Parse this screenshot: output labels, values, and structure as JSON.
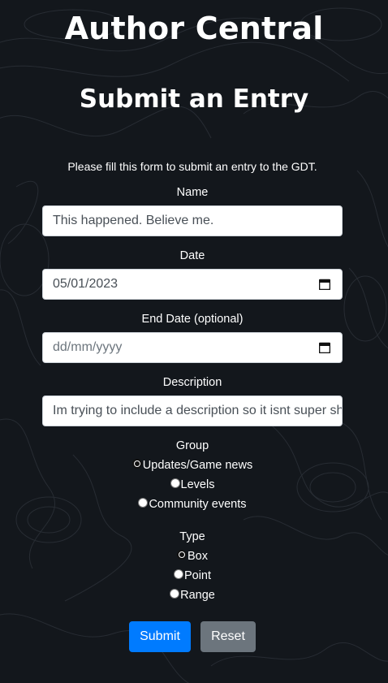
{
  "header": {
    "site_title": "Author Central",
    "page_title": "Submit an Entry",
    "intro": "Please fill this form to submit an entry to the GDT."
  },
  "form": {
    "name_label": "Name",
    "name_value": "This happened. Believe me.",
    "date_label": "Date",
    "date_value": "05/01/2023",
    "end_date_label": "End Date (optional)",
    "end_date_placeholder": "dd/mm/yyyy",
    "description_label": "Description",
    "description_value": "Im trying to include a description so it isnt super short",
    "group_label": "Group",
    "group_options": [
      {
        "label": "Updates/Game news",
        "checked": true
      },
      {
        "label": "Levels",
        "checked": false
      },
      {
        "label": "Community events",
        "checked": false
      }
    ],
    "type_label": "Type",
    "type_options": [
      {
        "label": "Box",
        "checked": true
      },
      {
        "label": "Point",
        "checked": false
      },
      {
        "label": "Range",
        "checked": false
      }
    ],
    "submit_label": "Submit",
    "reset_label": "Reset"
  },
  "colors": {
    "background": "#13171c",
    "submit_button": "#007bff",
    "reset_button": "#6c757d"
  },
  "icons": {
    "date_picker": "calendar-icon"
  }
}
